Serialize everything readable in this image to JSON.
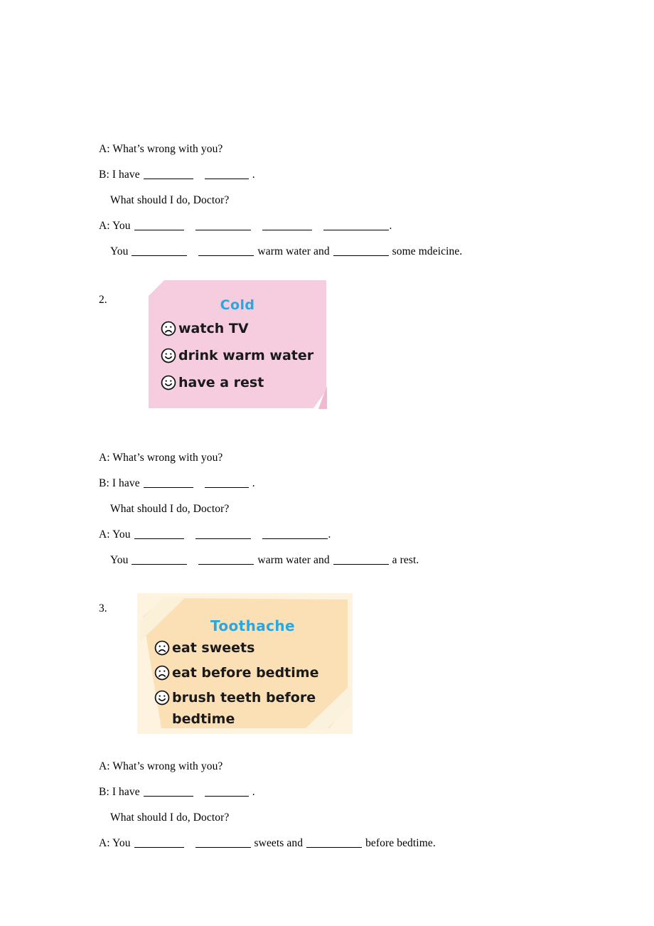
{
  "document": {
    "type": "english-worksheet",
    "page_background": "#ffffff"
  },
  "colors": {
    "card_title": "#29a8e0",
    "pink_card": "#f5cddf",
    "pink_card_fold": "#f0b9cf",
    "orange_card": "#fbdfb5",
    "orange_card_border": "#fdf3df",
    "orange_card_tape": "#fbf0d8",
    "text": "#000000"
  },
  "dialogues": [
    {
      "id": "dialogue-1",
      "lines": [
        {
          "speaker": "A: ",
          "text": "What’s wrong with you?"
        },
        {
          "speaker": "B: ",
          "text": "I have"
        },
        {
          "speaker": "",
          "text": "What should I do, Doctor?"
        },
        {
          "speaker": "A: ",
          "text": "You"
        },
        {
          "speaker": "",
          "text": "You"
        }
      ],
      "line_1": "A: What’s wrong with you?",
      "line_2_prefix": "B: I have",
      "line_2_suffix": ".",
      "line_3": "What should I do, Doctor?",
      "line_4_prefix": "A: You",
      "line_4_suffix": ".",
      "line_5_prefix": "You",
      "line_5_mid": "warm water and",
      "line_5_suffix": "some mdeicine."
    },
    {
      "id": "dialogue-2",
      "line_1": "A: What’s wrong with you?",
      "line_2_prefix": "B: I have",
      "line_2_suffix": ".",
      "line_3": "What should I do, Doctor?",
      "line_4_prefix": "A: You",
      "line_4_suffix": ".",
      "line_5_prefix": "You",
      "line_5_mid": "warm water and",
      "line_5_suffix": "a rest."
    },
    {
      "id": "dialogue-3",
      "line_1": "A: What’s wrong with you?",
      "line_2_prefix": "B: I have",
      "line_2_suffix": ".",
      "line_3": "What should I do, Doctor?",
      "line_4_prefix": "A: You",
      "line_4_mid": "sweets and",
      "line_4_suffix": "before bedtime."
    }
  ],
  "items": [
    {
      "number": "2.",
      "card": {
        "title": "Cold",
        "style": "pink",
        "entries": [
          {
            "face": "sad-face-icon",
            "mood": "sad",
            "text": "watch TV"
          },
          {
            "face": "happy-face-icon",
            "mood": "happy",
            "text": "drink warm water"
          },
          {
            "face": "happy-face-icon",
            "mood": "happy",
            "text": "have a rest"
          }
        ]
      }
    },
    {
      "number": "3.",
      "card": {
        "title": "Toothache",
        "style": "orange",
        "entries": [
          {
            "face": "sad-face-icon",
            "mood": "sad",
            "text": "eat sweets"
          },
          {
            "face": "sad-face-icon",
            "mood": "sad",
            "text": "eat before bedtime"
          },
          {
            "face": "happy-face-icon",
            "mood": "happy",
            "text": "brush teeth before\nbedtime"
          }
        ]
      }
    }
  ]
}
